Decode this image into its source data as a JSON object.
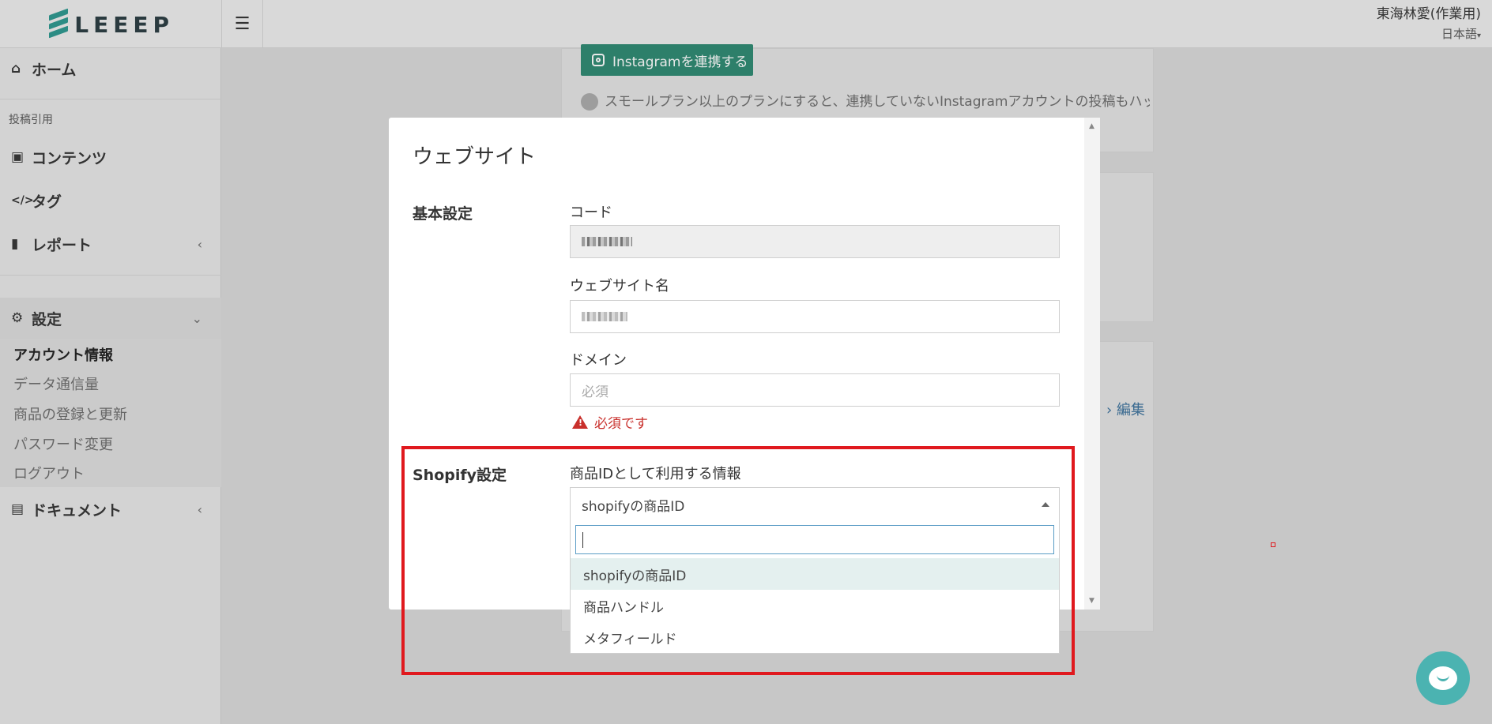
{
  "app": {
    "logo_text": "LEEEP",
    "user_name": "東海林愛(作業用)",
    "language": "日本語"
  },
  "sidebar": {
    "home": "ホーム",
    "section_quote": "投稿引用",
    "contents": "コンテンツ",
    "tags": "タグ",
    "report": "レポート",
    "settings": "設定",
    "settings_sub": [
      "アカウント情報",
      "データ通信量",
      "商品の登録と更新",
      "パスワード変更",
      "ログアウト"
    ],
    "documents": "ドキュメント"
  },
  "background": {
    "instagram_button": "Instagramを連携する",
    "hint_text": "スモールプラン以上のプランにすると、連携していないInstagramアカウントの投稿もハッシュ",
    "edit_link": "編集"
  },
  "modal": {
    "title": "ウェブサイト",
    "basic_section": "基本設定",
    "code_label": "コード",
    "site_name_label": "ウェブサイト名",
    "domain_label": "ドメイン",
    "domain_placeholder": "必須",
    "domain_error": "必須です",
    "shopify_section": "Shopify設定",
    "product_id_label": "商品IDとして利用する情報",
    "product_id_selected": "shopifyの商品ID",
    "product_id_options": [
      "shopifyの商品ID",
      "商品ハンドル",
      "メタフィールド"
    ]
  },
  "colors": {
    "accent": "#2c8c84",
    "error": "#c9302c",
    "highlight_box": "#e0191e",
    "chat": "#4bb3b1"
  },
  "icons": [
    "home-icon",
    "image-icon",
    "code-icon",
    "bar-chart-icon",
    "gear-icon",
    "document-icon",
    "instagram-icon",
    "lightbulb-icon",
    "warning-icon",
    "chat-icon",
    "hamburger-icon"
  ]
}
